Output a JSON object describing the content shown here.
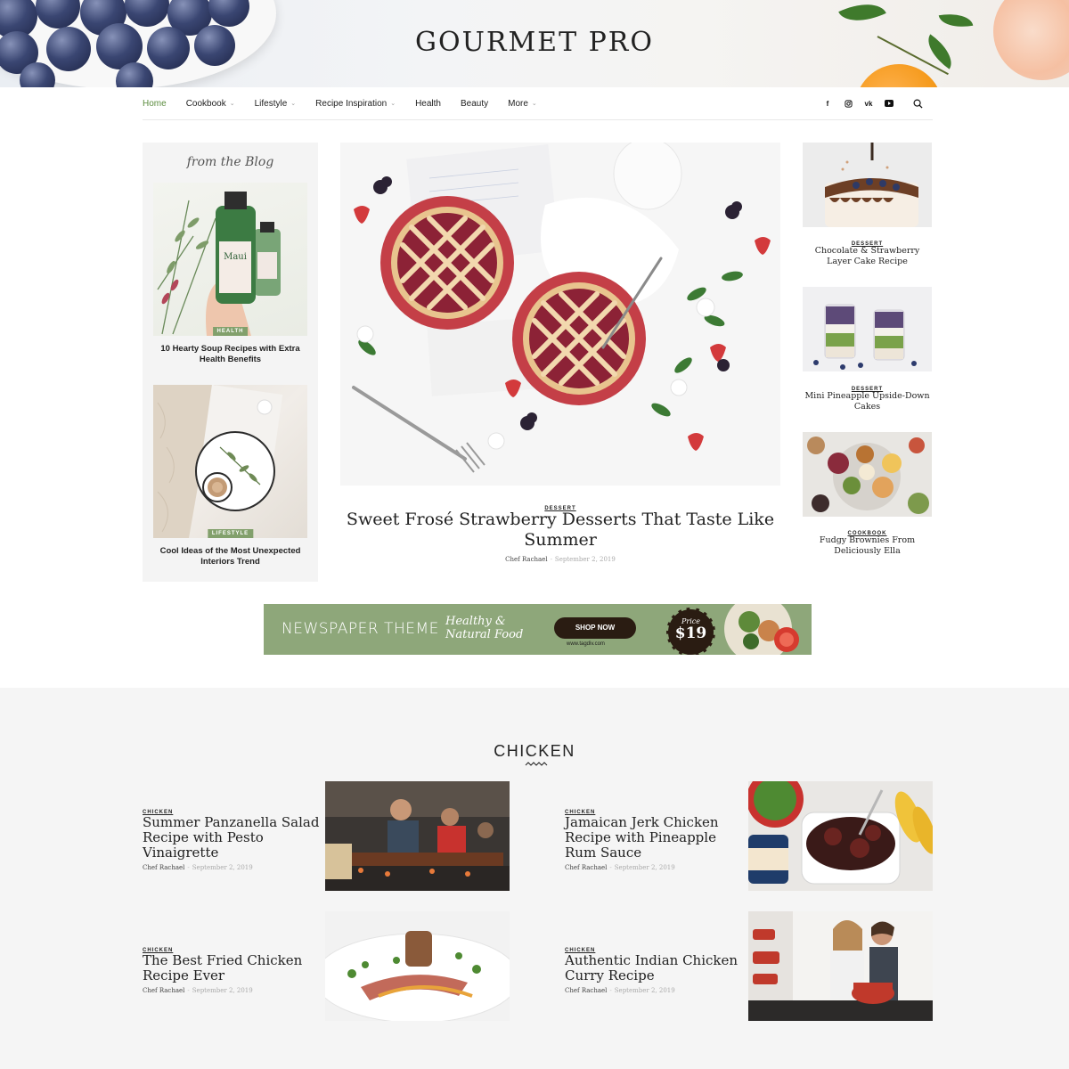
{
  "site": {
    "title": "GOURMET PRO"
  },
  "nav": {
    "items": [
      {
        "label": "Home",
        "active": true,
        "dropdown": false
      },
      {
        "label": "Cookbook",
        "active": false,
        "dropdown": true
      },
      {
        "label": "Lifestyle",
        "active": false,
        "dropdown": true
      },
      {
        "label": "Recipe Inspiration",
        "active": false,
        "dropdown": true
      },
      {
        "label": "Health",
        "active": false,
        "dropdown": false
      },
      {
        "label": "Beauty",
        "active": false,
        "dropdown": false
      },
      {
        "label": "More",
        "active": false,
        "dropdown": true
      }
    ],
    "social_icons": [
      "facebook-icon",
      "instagram-icon",
      "vk-icon",
      "youtube-icon"
    ],
    "search_icon": "search-icon"
  },
  "blog_box": {
    "heading": "from the Blog",
    "posts": [
      {
        "tag": "HEALTH",
        "title": "10 Hearty Soup Recipes with Extra Health Benefits",
        "bottle_label": "Maui"
      },
      {
        "tag": "LIFESTYLE",
        "title": "Cool Ideas of the Most Unexpected Interiors Trend"
      }
    ]
  },
  "featured": {
    "category": "DESSERT",
    "title": "Sweet Frosé Strawberry Desserts That Taste Like Summer",
    "author": "Chef Rachael",
    "separator": "-",
    "date": "September 2, 2019"
  },
  "sidebar": {
    "posts": [
      {
        "category": "DESSERT",
        "title": "Chocolate & Strawberry Layer Cake Recipe"
      },
      {
        "category": "DESSERT",
        "title": "Mini Pineapple Upside-Down Cakes"
      },
      {
        "category": "COOKBOOK",
        "title": "Fudgy Brownies From Deliciously Ella"
      }
    ]
  },
  "banner": {
    "brand": "NEWSPAPER THEME",
    "tagline": "Healthy & Natural Food",
    "button": "SHOP NOW",
    "url": "www.tagdiv.com",
    "price_label": "Price",
    "price_value": "$19",
    "colors": {
      "background": "#8ea77a",
      "button": "#2a1c12"
    }
  },
  "chicken_section": {
    "title": "CHICKEN",
    "posts": [
      {
        "category": "CHICKEN",
        "title": "Summer Panzanella Salad Recipe with Pesto Vinaigrette",
        "author": "Chef Rachael",
        "separator": "-",
        "date": "September 2, 2019"
      },
      {
        "category": "CHICKEN",
        "title": "Jamaican Jerk Chicken Recipe with Pineapple Rum Sauce",
        "author": "Chef Rachael",
        "separator": "-",
        "date": "September 2, 2019"
      },
      {
        "category": "CHICKEN",
        "title": "The Best Fried Chicken Recipe Ever",
        "author": "Chef Rachael",
        "separator": "-",
        "date": "September 2, 2019"
      },
      {
        "category": "CHICKEN",
        "title": "Authentic Indian Chicken Curry Recipe",
        "author": "Chef Rachael",
        "separator": "-",
        "date": "September 2, 2019"
      }
    ]
  },
  "colors": {
    "accent_green": "#5b8c3e",
    "tag_green": "#82a06c",
    "section_bg": "#f5f5f5"
  }
}
